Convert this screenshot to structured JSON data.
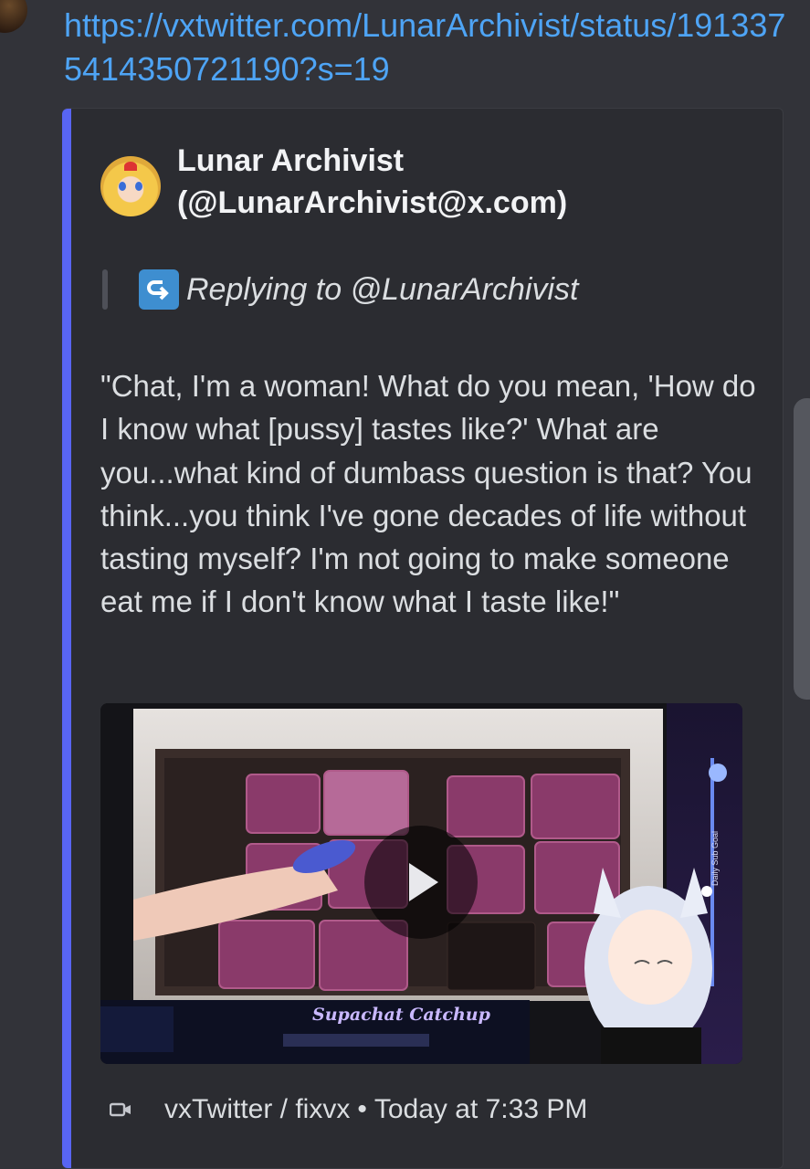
{
  "message": {
    "link_text": "https://vxtwitter.com/LunarArchivist/status/1913375414350721190?s=19"
  },
  "embed": {
    "accent_color": "#5865f2",
    "author": {
      "name": "Lunar Archivist",
      "handle": "(@LunarArchivist@x.com)"
    },
    "reply": {
      "icon": "reply-arrow-icon",
      "text": "Replying to @LunarArchivist"
    },
    "text": "\"Chat, I'm a woman! What do you mean, 'How do I know what [pussy] tastes like?' What are you...what kind of dumbass question is that? You think...you think I've gone decades of life without tasting myself? I'm not going to make someone eat me if I don't know what I taste like!\"",
    "media": {
      "play_icon": "play-icon",
      "overlay_banner": "Supachat Catchup",
      "side_label": "Daily Sub Goal"
    },
    "footer": {
      "icon": "video-camera-icon",
      "provider": "vxTwitter / fixvx",
      "separator": "•",
      "timestamp": "Today at 7:33 PM"
    }
  }
}
